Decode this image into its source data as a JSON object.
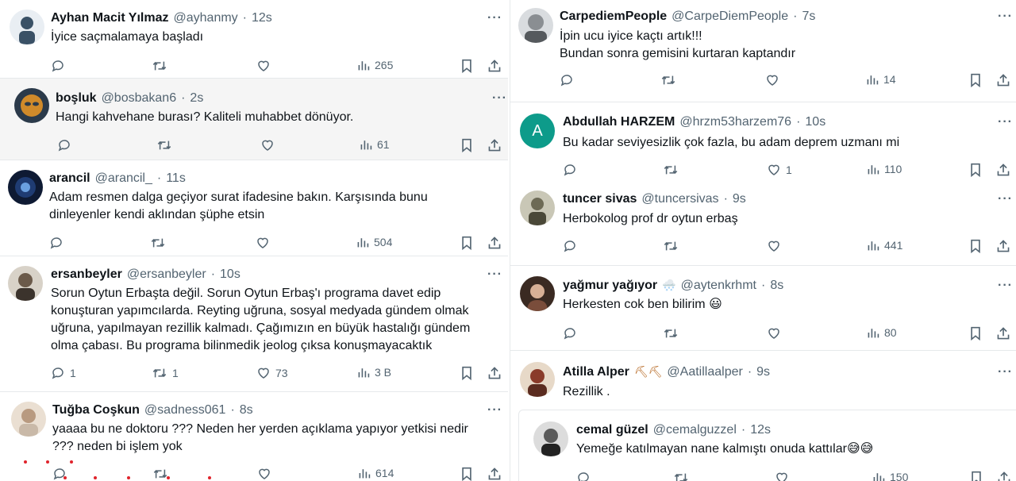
{
  "left": [
    {
      "name": "Ayhan Macit Yılmaz",
      "handle": "@ayhanmy",
      "time": "12s",
      "text": [
        "İyice saçmalamaya başladı"
      ],
      "replies": "",
      "retweets": "",
      "likes": "",
      "views": "265",
      "avatar_color": "#3a5166"
    },
    {
      "name": "boşluk",
      "handle": "@bosbakan6",
      "time": "2s",
      "text": [
        "Hangi kahvehane burası? Kaliteli muhabbet dönüyor."
      ],
      "replies": "",
      "retweets": "",
      "likes": "",
      "views": "61",
      "avatar_color": "#2b3a4a"
    },
    {
      "name": "arancil",
      "handle": "@arancil_",
      "time": "11s",
      "text": [
        "Adam resmen dalga geçiyor surat ifadesine bakın. Karşısında bunu",
        "dinleyenler kendi aklından şüphe etsin"
      ],
      "replies": "",
      "retweets": "",
      "likes": "",
      "views": "504",
      "avatar_color": "#1f3c73"
    },
    {
      "name": "ersanbeyler",
      "handle": "@ersanbeyler",
      "time": "10s",
      "text": [
        "Sorun Oytun Erbaşta değil. Sorun Oytun Erbaş'ı programa davet edip",
        "konuşturan yapımcılarda. Reyting uğruna, sosyal medyada gündem olmak",
        "uğruna, yapılmayan rezillik kalmadı. Çağımızın en büyük hastalığı gündem",
        "olma çabası. Bu programa bilinmedik jeolog çıksa konuşmayacaktık"
      ],
      "replies": "1",
      "retweets": "1",
      "likes": "73",
      "views": "3 B",
      "avatar_color": "#6b5a4a"
    },
    {
      "name": "Tuğba Coşkun",
      "handle": "@sadness061",
      "time": "8s",
      "text": [
        "yaaaa bu ne doktoru ??? Neden her yerden açıklama yapıyor yetkisi nedir",
        "??? neden bi işlem yok"
      ],
      "replies": "",
      "retweets": "",
      "likes": "",
      "views": "614",
      "avatar_color": "#c9b9a8"
    }
  ],
  "right": [
    {
      "name": "CarpediemPeople",
      "handle": "@CarpeDiemPeople",
      "time": "7s",
      "text": [
        "İpin ucu iyice kaçtı artık!!!",
        "Bundan sonra gemisini kurtaran kaptandır"
      ],
      "replies": "",
      "retweets": "",
      "likes": "",
      "views": "14",
      "avatar_color": "#8a8e92"
    },
    {
      "name": "Abdullah HARZEM",
      "handle": "@hrzm53harzem76",
      "time": "10s",
      "text": [
        "Bu kadar seviyesizlik çok fazla, bu adam deprem uzmanı mi"
      ],
      "replies": "",
      "retweets": "",
      "likes": "1",
      "views": "110",
      "avatar_letter": "A",
      "avatar_color": "#0d9b8a"
    },
    {
      "name": "tuncer sivas",
      "handle": "@tuncersivas",
      "time": "9s",
      "text": [
        "Herbokolog prof dr oytun erbaş"
      ],
      "replies": "",
      "retweets": "",
      "likes": "",
      "views": "441",
      "avatar_color": "#6d6a55"
    },
    {
      "name": "yağmur yağıyor",
      "emoji": "🌨️",
      "handle": "@aytenkrhmt",
      "time": "8s",
      "text": [
        "Herkesten cok ben bilirim 😃"
      ],
      "replies": "",
      "retweets": "",
      "likes": "",
      "views": "80",
      "avatar_color": "#7a4d3b"
    },
    {
      "name": "Atilla Alper",
      "emoji": "⛏⛏",
      "handle": "@Aatillaalper",
      "time": "9s",
      "text": [
        "Rezillik ."
      ],
      "replies": "",
      "retweets": "",
      "likes": "",
      "views": "",
      "avatar_color": "#8a3b2a"
    },
    {
      "name": "cemal güzel",
      "handle": "@cemalguzzel",
      "time": "12s",
      "text": [
        "Yemeğe katılmayan nane kalmıştı onuda kattılar😅😅"
      ],
      "replies": "",
      "retweets": "",
      "likes": "",
      "views": "150",
      "avatar_color": "#5a5a5a"
    }
  ],
  "colors": {
    "text": "#0f1419",
    "muted": "#536471",
    "shaded_bg": "#f5f5f5",
    "divider": "#e6e9eb"
  },
  "icons": [
    "reply-icon",
    "retweet-icon",
    "like-icon",
    "views-icon",
    "bookmark-icon",
    "share-icon",
    "more-icon"
  ]
}
